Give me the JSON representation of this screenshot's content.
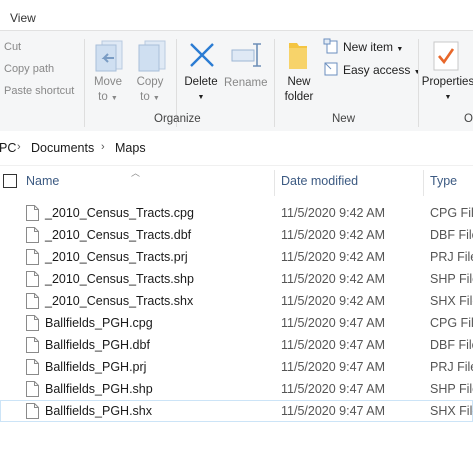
{
  "tabs": {
    "view": "View"
  },
  "ribbon": {
    "clipboard": {
      "cut": "Cut",
      "copy_path": "Copy path",
      "paste_shortcut": "Paste shortcut"
    },
    "organize": {
      "move_to": [
        "Move",
        "to"
      ],
      "copy_to": [
        "Copy",
        "to"
      ],
      "delete": "Delete",
      "rename": "Rename",
      "group_label": "Organize"
    },
    "new": {
      "new_folder": [
        "New",
        "folder"
      ],
      "new_item": "New item",
      "easy_access": "Easy access",
      "group_label": "New"
    },
    "open": {
      "properties": "Properties",
      "group_label": "O"
    }
  },
  "address": {
    "root": "PC",
    "crumbs": [
      "Documents",
      "Maps"
    ]
  },
  "columns": {
    "name": "Name",
    "date_modified": "Date modified",
    "type": "Type"
  },
  "files": [
    {
      "name": "_2010_Census_Tracts.cpg",
      "date": "11/5/2020 9:42 AM",
      "type": "CPG File"
    },
    {
      "name": "_2010_Census_Tracts.dbf",
      "date": "11/5/2020 9:42 AM",
      "type": "DBF File"
    },
    {
      "name": "_2010_Census_Tracts.prj",
      "date": "11/5/2020 9:42 AM",
      "type": "PRJ File"
    },
    {
      "name": "_2010_Census_Tracts.shp",
      "date": "11/5/2020 9:42 AM",
      "type": "SHP File"
    },
    {
      "name": "_2010_Census_Tracts.shx",
      "date": "11/5/2020 9:42 AM",
      "type": "SHX File"
    },
    {
      "name": "Ballfields_PGH.cpg",
      "date": "11/5/2020 9:47 AM",
      "type": "CPG File"
    },
    {
      "name": "Ballfields_PGH.dbf",
      "date": "11/5/2020 9:47 AM",
      "type": "DBF File"
    },
    {
      "name": "Ballfields_PGH.prj",
      "date": "11/5/2020 9:47 AM",
      "type": "PRJ File"
    },
    {
      "name": "Ballfields_PGH.shp",
      "date": "11/5/2020 9:47 AM",
      "type": "SHP File"
    },
    {
      "name": "Ballfields_PGH.shx",
      "date": "11/5/2020 9:47 AM",
      "type": "SHX File"
    }
  ],
  "selected_index": 9,
  "colors": {
    "accent_blue": "#2b7cd3",
    "header_text": "#3c5a82",
    "folder_yellow": "#f4c542",
    "check_orange": "#e8672a",
    "delete_x": "#2b7cd3"
  },
  "icons": {
    "file": "generic-file-icon",
    "folder": "folder-icon"
  }
}
